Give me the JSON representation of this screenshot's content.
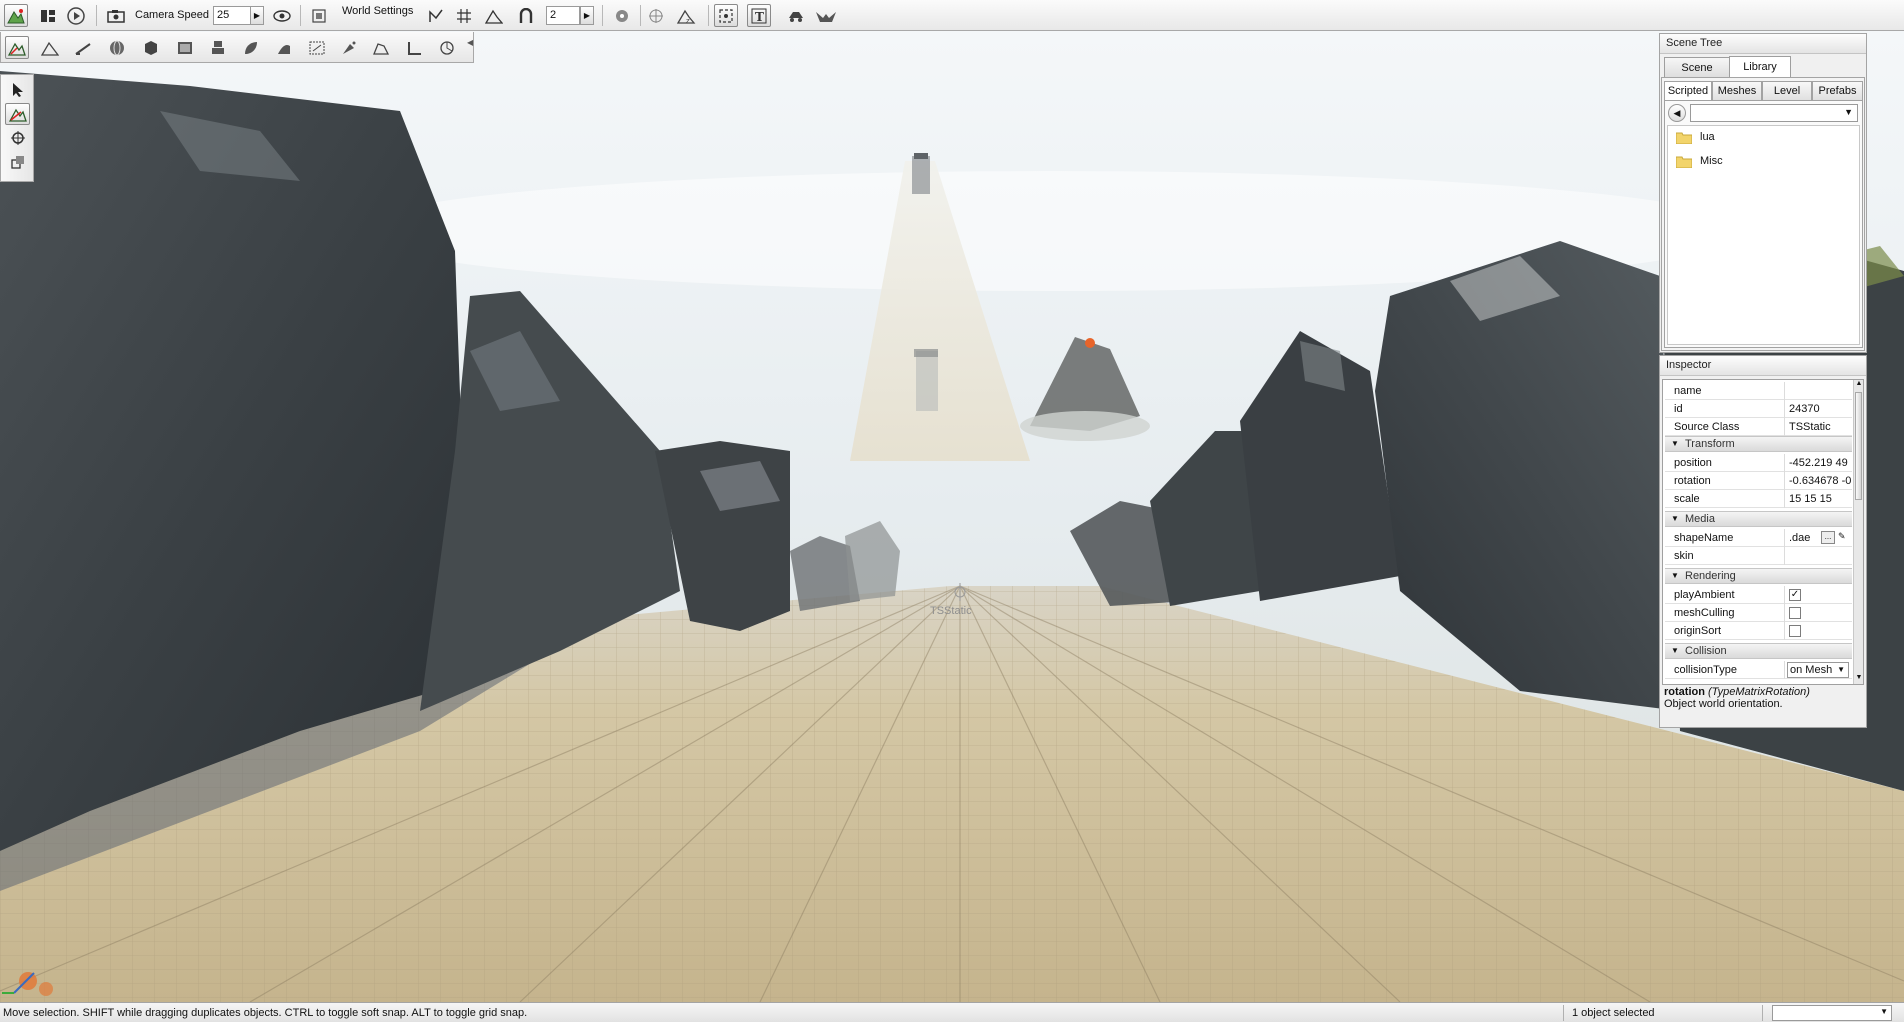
{
  "toolbar": {
    "camera_speed_label": "Camera Speed",
    "camera_speed_value": "25",
    "world_settings_label": "World Settings",
    "snap_value": "2"
  },
  "viewport": {
    "selected_object_label": "TSStatic"
  },
  "scene_tree": {
    "title": "Scene Tree",
    "tabs": [
      {
        "label": "Scene"
      },
      {
        "label": "Library"
      }
    ],
    "active_tab": "Library",
    "subtabs": [
      {
        "label": "Scripted"
      },
      {
        "label": "Meshes"
      },
      {
        "label": "Level"
      },
      {
        "label": "Prefabs"
      }
    ],
    "active_subtab": "Scripted",
    "path_value": "",
    "items": [
      {
        "label": "lua"
      },
      {
        "label": "Misc"
      }
    ]
  },
  "inspector": {
    "title": "Inspector",
    "fields": {
      "name": {
        "label": "name",
        "value": ""
      },
      "id": {
        "label": "id",
        "value": "24370"
      },
      "source_class": {
        "label": "Source Class",
        "value": "TSStatic"
      }
    },
    "transform": {
      "title": "Transform",
      "position": {
        "label": "position",
        "value": "-452.219 49"
      },
      "rotation": {
        "label": "rotation",
        "value": "-0.634678 -0"
      },
      "scale": {
        "label": "scale",
        "value": "15 15 15"
      }
    },
    "media": {
      "title": "Media",
      "shape_name": {
        "label": "shapeName",
        "value": ".dae"
      },
      "skin": {
        "label": "skin",
        "value": ""
      }
    },
    "rendering": {
      "title": "Rendering",
      "play_ambient": {
        "label": "playAmbient",
        "checked": true
      },
      "mesh_culling": {
        "label": "meshCulling",
        "checked": false
      },
      "origin_sort": {
        "label": "originSort",
        "checked": false
      }
    },
    "collision": {
      "title": "Collision",
      "collision_type": {
        "label": "collisionType",
        "value": "on Mesh"
      }
    },
    "help": {
      "field": "rotation",
      "type": "(TypeMatrixRotation)",
      "description": "Object world orientation."
    }
  },
  "statusbar": {
    "message": "Move selection.  SHIFT while dragging duplicates objects.  CTRL to toggle soft snap.  ALT to toggle grid snap.",
    "selection_count": "1 object selected"
  },
  "colors": {
    "sky": "#eaf0f4",
    "ground": "#d6c8a8",
    "grid_line": "#a8987a",
    "rock_dark": "#33393e",
    "rock_light": "#5c6468",
    "panel_bg": "#f0f0f0"
  }
}
